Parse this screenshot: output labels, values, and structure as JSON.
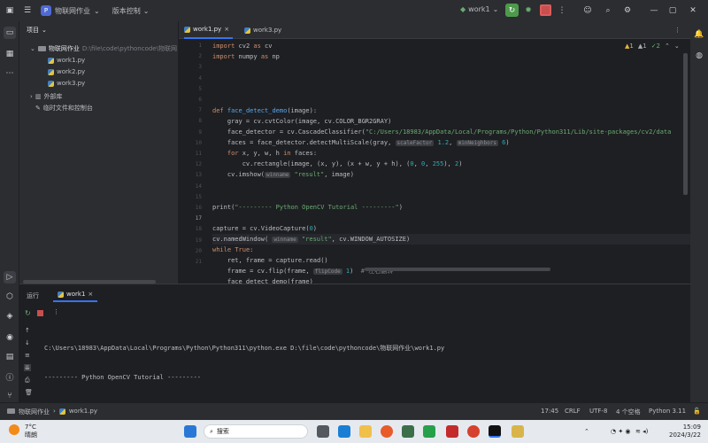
{
  "titlebar": {
    "project_badge": "P",
    "project_name": "物联网作业",
    "vcs_branch": "版本控制",
    "run_config": "work1"
  },
  "project_panel": {
    "title": "项目",
    "root": "物联网作业",
    "root_path": "D:\\file\\code\\pythoncode\\物联网",
    "files": [
      "work1.py",
      "work2.py",
      "work3.py"
    ],
    "external": "外部库",
    "scratches": "临时文件和控制台"
  },
  "editor": {
    "tabs": [
      {
        "label": "work1.py"
      },
      {
        "label": "work3.py"
      }
    ],
    "warnings": "▲1",
    "weak": "▲1",
    "ok": "✓2",
    "line_numbers": [
      "1",
      "2",
      "3",
      "4",
      "5",
      "6",
      "7",
      "8",
      "9",
      "10",
      "11",
      "12",
      "13",
      "14",
      "15",
      "16",
      "17",
      "18",
      "19",
      "20",
      "21"
    ]
  },
  "run": {
    "tab_label": "运行",
    "config_label": "work1",
    "output": [
      "C:\\Users\\18983\\AppData\\Local\\Programs\\Python\\Python311\\python.exe D:\\file\\code\\pythoncode\\物联网作业\\work1.py",
      "--------- Python OpenCV Tutorial ---------"
    ]
  },
  "statusbar": {
    "breadcrumb_project": "物联网作业",
    "breadcrumb_file": "work1.py",
    "position": "17:45",
    "line_sep": "CRLF",
    "encoding": "UTF-8",
    "indent": "4 个空格",
    "interpreter": "Python 3.11"
  },
  "taskbar": {
    "weather_temp": "7°C",
    "weather_desc": "晴朗",
    "search_placeholder": "搜索",
    "time": "15:09",
    "date": "2024/3/22"
  }
}
